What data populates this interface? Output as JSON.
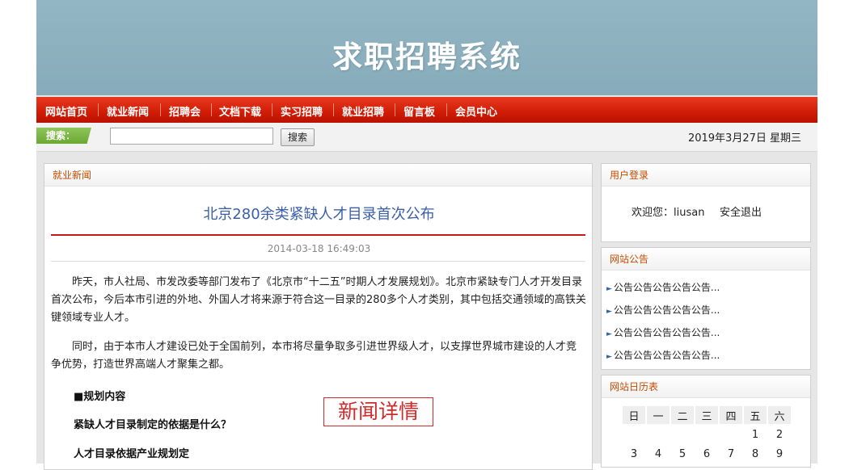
{
  "site": {
    "title": "求职招聘系统"
  },
  "nav": {
    "items": [
      "网站首页",
      "就业新闻",
      "招聘会",
      "文档下载",
      "实习招聘",
      "就业招聘",
      "留言板",
      "会员中心"
    ]
  },
  "search": {
    "label": "搜索：",
    "placeholder": "",
    "button": "搜索"
  },
  "date": "2019年3月27日 星期三",
  "article": {
    "panel_title": "就业新闻",
    "title": "北京280余类紧缺人才目录首次公布",
    "time": "2014-03-18 16:49:03",
    "para1": "昨天，市人社局、市发改委等部门发布了《北京市“十二五”时期人才发展规划》。北京市紧缺专门人才开发目录首次公布，今后本市引进的外地、外国人才将来源于符合这一目录的280多个人才类别，其中包括交通领域的高铁关键领域专业人才。",
    "para2": "同时，由于本市人才建设已处于全国前列，本市将尽量争取多引进世界级人才，以支撑世界城市建设的人才竞争优势，打造世界高端人才聚集之都。",
    "h_plan": "■规划内容",
    "q1": "紧缺人才目录制定的依据是什么？",
    "a1": "人才目录依据产业规划定",
    "stamp": "新闻详情"
  },
  "login": {
    "title": "用户登录",
    "welcome": "欢迎您：liusan",
    "logout": "安全退出"
  },
  "notice": {
    "title": "网站公告",
    "items": [
      "公告公告公告公告公告...",
      "公告公告公告公告公告...",
      "公告公告公告公告公告...",
      "公告公告公告公告公告..."
    ]
  },
  "calendar": {
    "title": "网站日历表",
    "weekdays": [
      "日",
      "一",
      "二",
      "三",
      "四",
      "五",
      "六"
    ],
    "row1": [
      "",
      "",
      "",
      "",
      "",
      "1",
      "2"
    ],
    "row2": [
      "3",
      "4",
      "5",
      "6",
      "7",
      "8",
      "9"
    ]
  }
}
